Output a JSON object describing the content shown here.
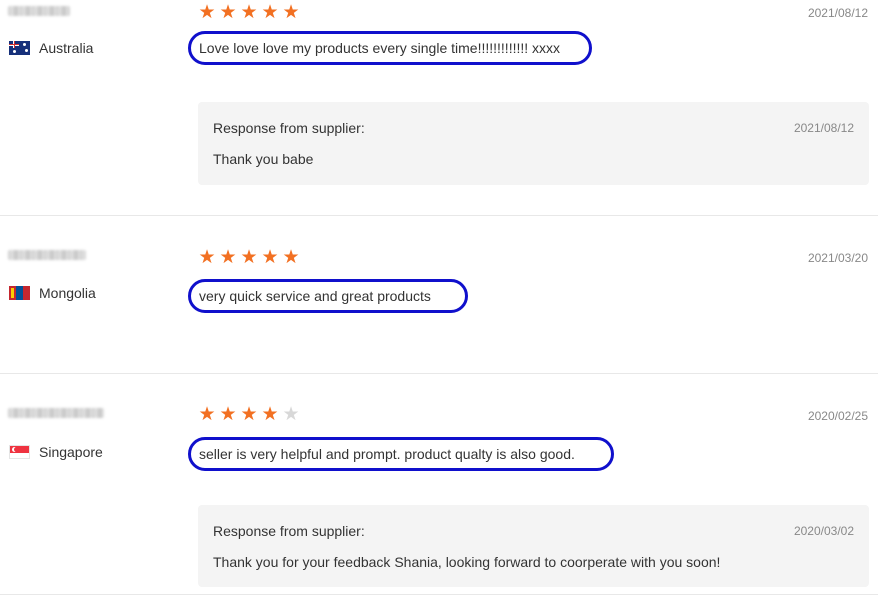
{
  "reviews": [
    {
      "country": "Australia",
      "flag": "australia-flag",
      "rating": 5,
      "date": "2021/08/12",
      "comment": "Love love love my products every single time!!!!!!!!!!!!! xxxx",
      "response": {
        "label": "Response from supplier:",
        "date": "2021/08/12",
        "text": "Thank you babe"
      }
    },
    {
      "country": "Mongolia",
      "flag": "mongolia-flag",
      "rating": 5,
      "date": "2021/03/20",
      "comment": "very quick service and great products"
    },
    {
      "country": "Singapore",
      "flag": "singapore-flag",
      "rating": 4,
      "date": "2020/02/25",
      "comment": "seller is very helpful and prompt. product qualty is also good.",
      "response": {
        "label": "Response from supplier:",
        "date": "2020/03/02",
        "text": "Thank you for your feedback Shania, looking forward to coorperate with you soon!"
      }
    }
  ],
  "colors": {
    "star_filled": "#f27022",
    "star_empty": "#d8d8d8",
    "annotation_ring": "#1010cc",
    "response_bg": "#f4f4f4"
  }
}
